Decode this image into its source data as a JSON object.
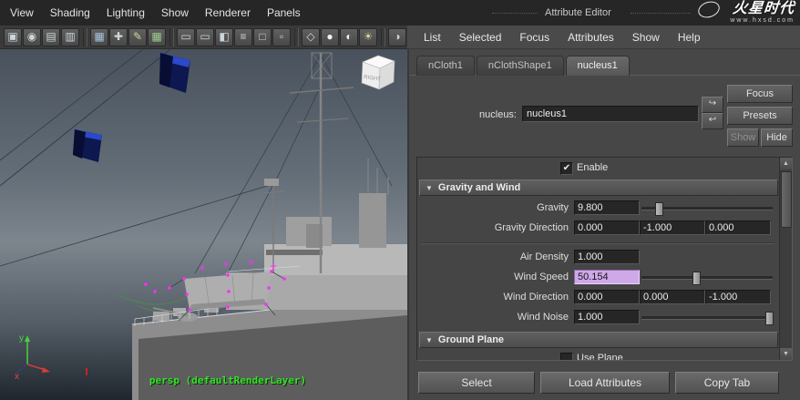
{
  "header": {
    "title": "Attribute Editor",
    "brand": "火星时代",
    "brand_url": "www.hxsd.com"
  },
  "panel_menu": {
    "items": [
      "View",
      "Shading",
      "Lighting",
      "Show",
      "Renderer",
      "Panels"
    ]
  },
  "viewport": {
    "hud_text": "persp (defaultRenderLayer)",
    "view_cube_face": "RIGHT",
    "axis": {
      "y": "y",
      "x": "x"
    },
    "toolbar_icons": [
      "select-camera-icon",
      "lock-camera-icon",
      "camera-attributes-icon",
      "bookmarks-icon",
      "image-plane-icon",
      "2d-pan-zoom-icon",
      "grease-pencil-icon",
      "grid-icon",
      "film-gate-icon",
      "resolution-gate-icon",
      "gate-mask-icon",
      "field-chart-icon",
      "safe-action-icon",
      "safe-title-icon",
      "wireframe-icon",
      "shaded-display-icon",
      "textured-display-icon",
      "use-all-lights-icon",
      "shadows-icon",
      "screen-space-ao-icon",
      "xray-icon"
    ]
  },
  "ae": {
    "menu": [
      "List",
      "Selected",
      "Focus",
      "Attributes",
      "Show",
      "Help"
    ],
    "tabs": [
      "nCloth1",
      "nClothShape1",
      "nucleus1"
    ],
    "nucleus_label": "nucleus:",
    "nucleus_value": "nucleus1",
    "buttons": {
      "focus": "Focus",
      "presets": "Presets",
      "show": "Show",
      "hide": "Hide"
    },
    "enable_label": "Enable",
    "sections": {
      "gravity_wind": "Gravity and Wind",
      "ground_plane": "Ground Plane",
      "use_plane": "Use Plane"
    },
    "rows": {
      "gravity": {
        "label": "Gravity",
        "value": "9.800"
      },
      "gravity_direction": {
        "label": "Gravity Direction",
        "x": "0.000",
        "y": "-1.000",
        "z": "0.000"
      },
      "air_density": {
        "label": "Air Density",
        "value": "1.000"
      },
      "wind_speed": {
        "label": "Wind Speed",
        "value": "50.154"
      },
      "wind_direction": {
        "label": "Wind Direction",
        "x": "0.000",
        "y": "0.000",
        "z": "-1.000"
      },
      "wind_noise": {
        "label": "Wind Noise",
        "value": "1.000"
      }
    },
    "bottom_buttons": {
      "select": "Select",
      "load": "Load Attributes",
      "copy": "Copy Tab"
    }
  },
  "colors": {
    "highlight_field": "#cfa8ea",
    "hud_green": "#37e02c",
    "flag_navy": "#0d1750",
    "vertex_magenta": "#ff2bff",
    "panel_bg": "#474747"
  }
}
